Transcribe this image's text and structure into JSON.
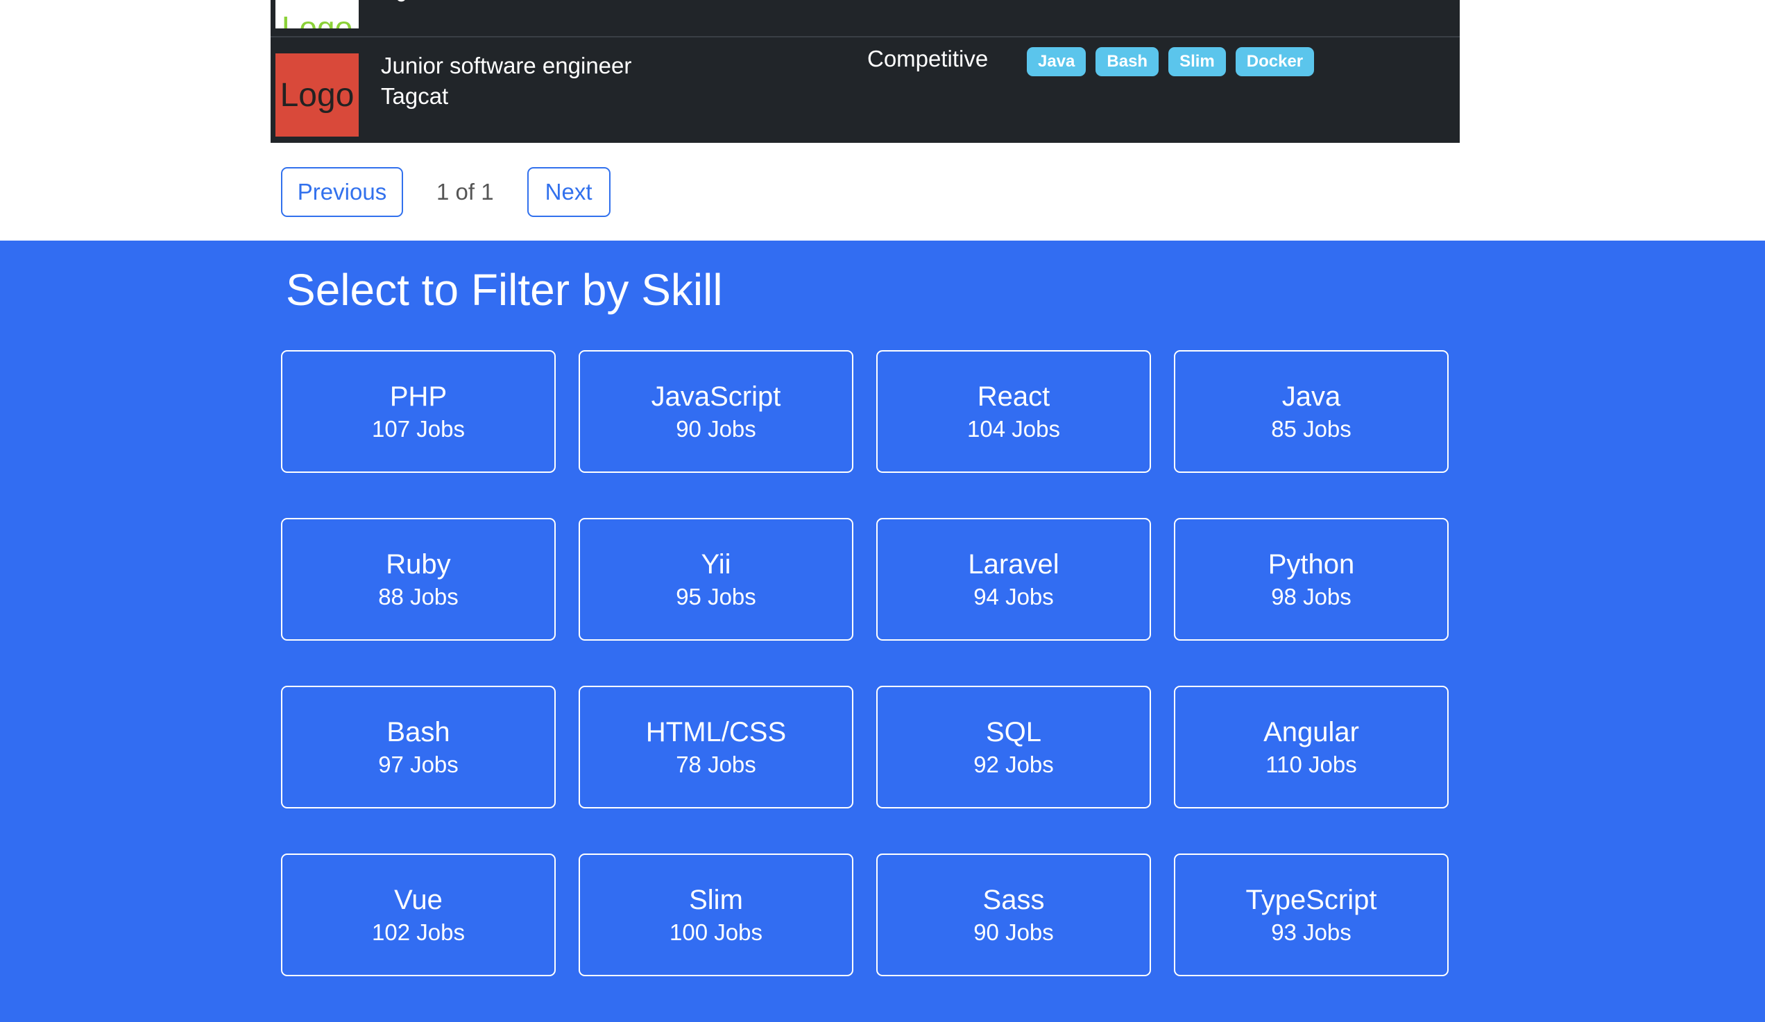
{
  "jobs": {
    "partial_row": {
      "logo_text": "Logo",
      "title_fragment": "J"
    },
    "row": {
      "logo_text": "Logo",
      "title": "Junior software engineer",
      "company": "Tagcat",
      "salary": "Competitive",
      "tags": [
        "Java",
        "Bash",
        "Slim",
        "Docker"
      ]
    }
  },
  "pagination": {
    "prev_label": "Previous",
    "info": "1 of 1",
    "next_label": "Next"
  },
  "skills": {
    "title": "Select to Filter by Skill",
    "items": [
      {
        "name": "PHP",
        "count": "107 Jobs"
      },
      {
        "name": "JavaScript",
        "count": "90 Jobs"
      },
      {
        "name": "React",
        "count": "104 Jobs"
      },
      {
        "name": "Java",
        "count": "85 Jobs"
      },
      {
        "name": "Ruby",
        "count": "88 Jobs"
      },
      {
        "name": "Yii",
        "count": "95 Jobs"
      },
      {
        "name": "Laravel",
        "count": "94 Jobs"
      },
      {
        "name": "Python",
        "count": "98 Jobs"
      },
      {
        "name": "Bash",
        "count": "97 Jobs"
      },
      {
        "name": "HTML/CSS",
        "count": "78 Jobs"
      },
      {
        "name": "SQL",
        "count": "92 Jobs"
      },
      {
        "name": "Angular",
        "count": "110 Jobs"
      },
      {
        "name": "Vue",
        "count": "102 Jobs"
      },
      {
        "name": "Slim",
        "count": "100 Jobs"
      },
      {
        "name": "Sass",
        "count": "90 Jobs"
      },
      {
        "name": "TypeScript",
        "count": "93 Jobs"
      }
    ]
  },
  "colors": {
    "table_bg": "#212529",
    "tag_bg": "#5bc5ec",
    "section_bg": "#326df2",
    "link": "#3271ed",
    "logo_red": "#d9493a",
    "logo_green_text": "#8bd138"
  }
}
